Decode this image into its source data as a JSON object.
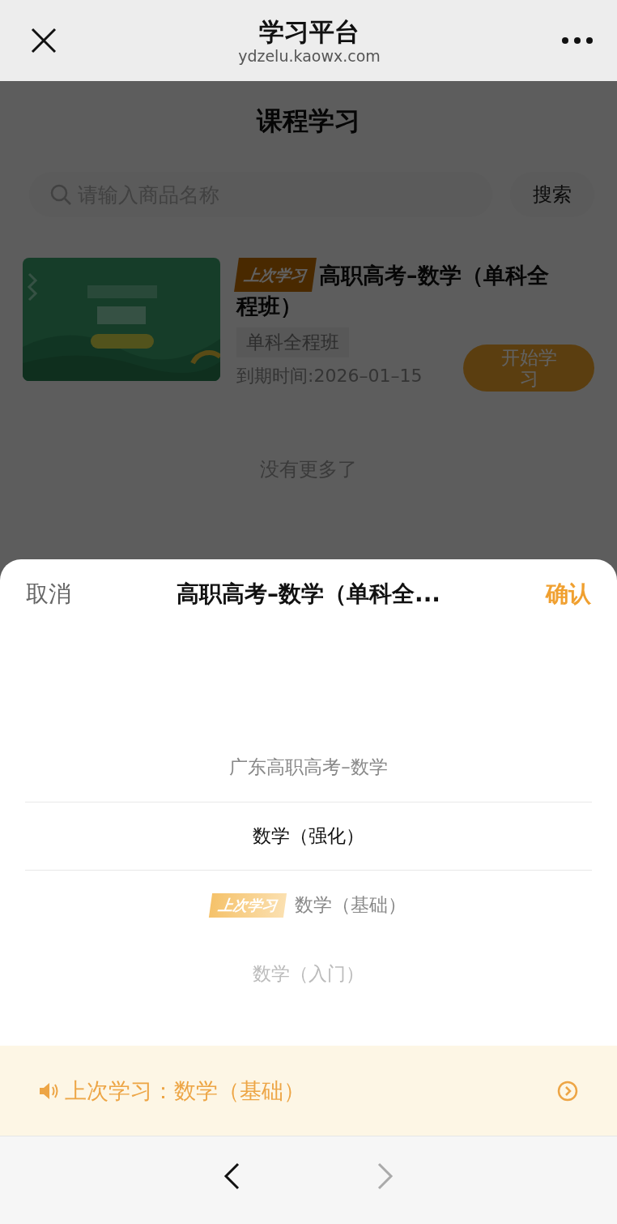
{
  "header": {
    "title": "学习平台",
    "url": "ydzelu.kaowx.com"
  },
  "page": {
    "title": "课程学习",
    "search": {
      "placeholder": "请输入商品名称",
      "button": "搜索"
    },
    "courses": [
      {
        "badge": "上次学习",
        "title": "高职高考–数学（单科全程班）",
        "tag": "单科全程班",
        "expiry": "到期时间:2026–01–15",
        "button": "开始学习"
      }
    ],
    "end_note": "没有更多了"
  },
  "picker": {
    "cancel": "取消",
    "title": "高职高考–数学（单科全...",
    "confirm": "确认",
    "items": [
      {
        "label": "广东高职高考–数学",
        "selected": false
      },
      {
        "label": "数学（强化）",
        "selected": true
      },
      {
        "label": "数学（基础）",
        "badge": "上次学习",
        "selected": false
      },
      {
        "label": "数学（入门）",
        "selected": false
      }
    ]
  },
  "last_study": {
    "text": "上次学习：数学（基础）"
  },
  "nav": {
    "back": {
      "disabled": false
    },
    "forward": {
      "disabled": true
    }
  }
}
